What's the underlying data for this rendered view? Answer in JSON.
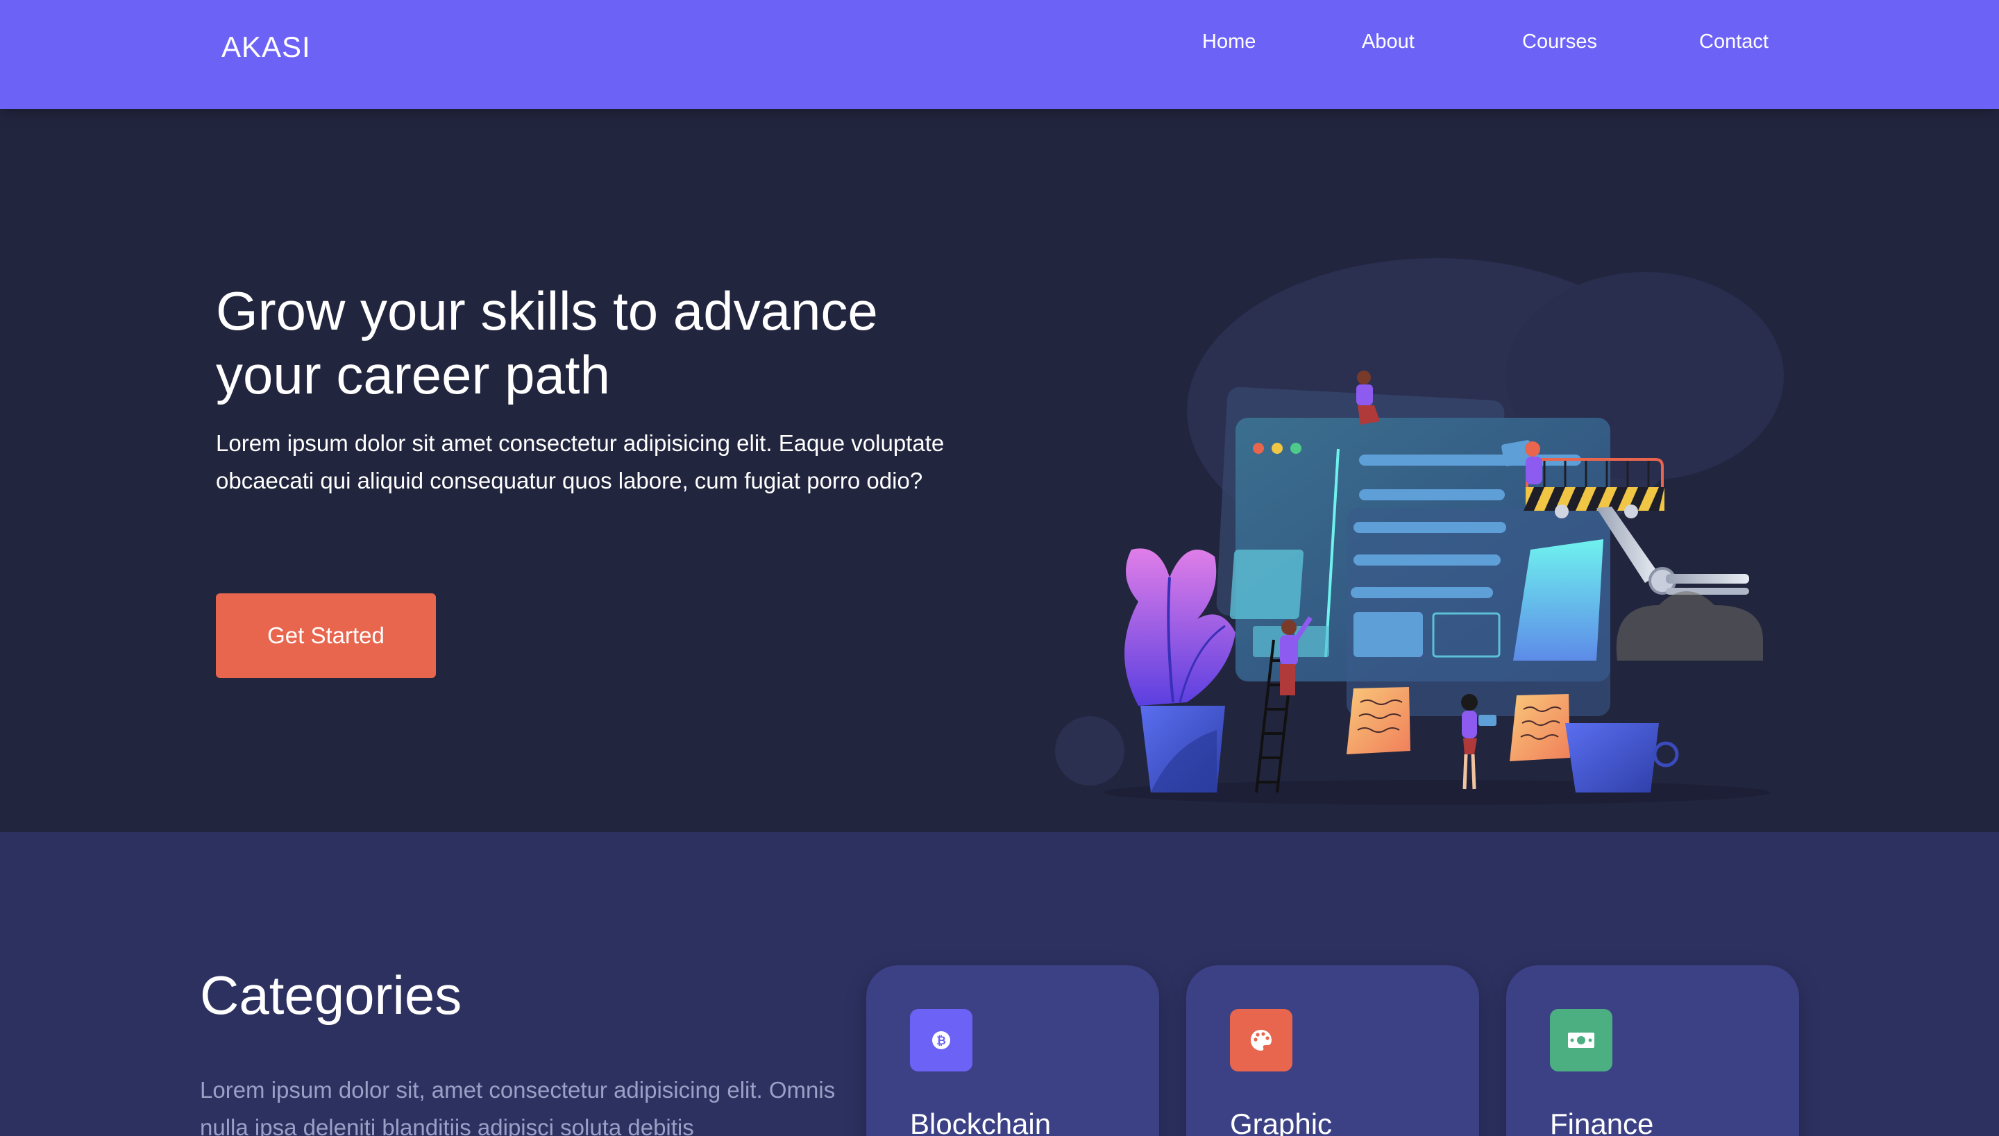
{
  "brand": {
    "logo": "AKASI"
  },
  "nav": {
    "home": "Home",
    "about": "About",
    "courses": "Courses",
    "contact": "Contact"
  },
  "hero": {
    "title": "Grow your skills to advance your career path",
    "text": "Lorem ipsum dolor sit amet consectetur adipisicing elit. Eaque voluptate obcaecati qui aliquid consequatur quos labore, cum fugiat porro odio?",
    "cta": "Get Started",
    "illustration_icon": "web-builders-illustration"
  },
  "categories": {
    "title": "Categories",
    "text": "Lorem ipsum dolor sit, amet consectetur adipisicing elit. Omnis nulla ipsa deleniti blanditiis adipisci soluta debitis",
    "cards": [
      {
        "label": "Blockchain",
        "icon": "bitcoin-icon",
        "color": "#6c63f6"
      },
      {
        "label": "Graphic",
        "icon": "palette-icon",
        "color": "#e8654e"
      },
      {
        "label": "Finance",
        "icon": "money-icon",
        "color": "#4caf82"
      }
    ]
  },
  "colors": {
    "nav_bg": "#6c63f6",
    "hero_bg": "#22253e",
    "categories_bg": "#2d3160",
    "card_bg": "#3c4185",
    "accent": "#e8654e"
  }
}
